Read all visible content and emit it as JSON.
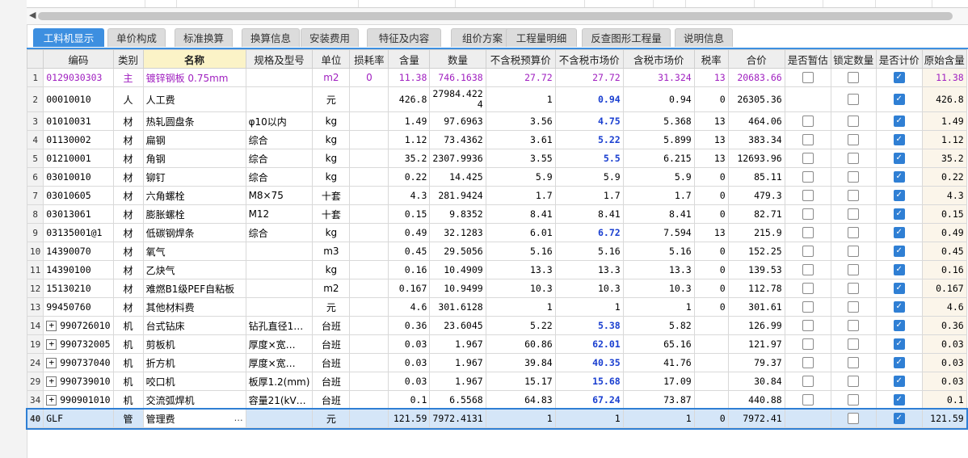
{
  "tabs": [
    {
      "label": "工料机显示",
      "active": true
    },
    {
      "label": "单价构成",
      "active": false
    },
    {
      "label": "标准换算",
      "active": false
    },
    {
      "label": "换算信息",
      "active": false
    },
    {
      "label": "安装费用",
      "active": false
    },
    {
      "label": "特征及内容",
      "active": false
    },
    {
      "label": "组价方案",
      "active": false
    },
    {
      "label": "工程量明细",
      "active": false
    },
    {
      "label": "反查图形工程量",
      "active": false
    },
    {
      "label": "说明信息",
      "active": false
    }
  ],
  "columns": [
    "编码",
    "类别",
    "名称",
    "规格及型号",
    "单位",
    "损耗率",
    "含量",
    "数量",
    "不含税预算价",
    "不含税市场价",
    "含税市场价",
    "税率",
    "合价",
    "是否暂估",
    "锁定数量",
    "是否计价",
    "原始含量"
  ],
  "rows": [
    {
      "idx": "1",
      "code": "0129030303",
      "cat": "主",
      "name": "镀锌钢板 0.75mm",
      "spec": "",
      "unit": "m2",
      "loss": "0",
      "content": "11.38",
      "qty": "746.1638",
      "pre": "27.72",
      "mkt": "27.72",
      "mkt_bold": false,
      "tax_mkt": "31.324",
      "rate": "13",
      "total": "20683.66",
      "est": false,
      "lock": false,
      "price": true,
      "orig": "11.38",
      "type": "main"
    },
    {
      "idx": "2",
      "code": "00010010",
      "cat": "人",
      "name": "人工费",
      "spec": "",
      "unit": "元",
      "loss": "",
      "content": "426.8",
      "qty": "27984.4224",
      "pre": "1",
      "mkt": "0.94",
      "mkt_bold": true,
      "tax_mkt": "0.94",
      "rate": "0",
      "total": "26305.36",
      "est": null,
      "lock": false,
      "price": true,
      "orig": "426.8",
      "type": "tall"
    },
    {
      "idx": "3",
      "code": "01010031",
      "cat": "材",
      "name": "热轧圆盘条",
      "spec": "φ10以内",
      "unit": "kg",
      "loss": "",
      "content": "1.49",
      "qty": "97.6963",
      "pre": "3.56",
      "mkt": "4.75",
      "mkt_bold": true,
      "tax_mkt": "5.368",
      "rate": "13",
      "total": "464.06",
      "est": false,
      "lock": false,
      "price": true,
      "orig": "1.49"
    },
    {
      "idx": "4",
      "code": "01130002",
      "cat": "材",
      "name": "扁钢",
      "spec": "综合",
      "unit": "kg",
      "loss": "",
      "content": "1.12",
      "qty": "73.4362",
      "pre": "3.61",
      "mkt": "5.22",
      "mkt_bold": true,
      "tax_mkt": "5.899",
      "rate": "13",
      "total": "383.34",
      "est": false,
      "lock": false,
      "price": true,
      "orig": "1.12"
    },
    {
      "idx": "5",
      "code": "01210001",
      "cat": "材",
      "name": "角钢",
      "spec": "综合",
      "unit": "kg",
      "loss": "",
      "content": "35.2",
      "qty": "2307.9936",
      "pre": "3.55",
      "mkt": "5.5",
      "mkt_bold": true,
      "tax_mkt": "6.215",
      "rate": "13",
      "total": "12693.96",
      "est": false,
      "lock": false,
      "price": true,
      "orig": "35.2"
    },
    {
      "idx": "6",
      "code": "03010010",
      "cat": "材",
      "name": "铆钉",
      "spec": "综合",
      "unit": "kg",
      "loss": "",
      "content": "0.22",
      "qty": "14.425",
      "pre": "5.9",
      "mkt": "5.9",
      "mkt_bold": false,
      "tax_mkt": "5.9",
      "rate": "0",
      "total": "85.11",
      "est": false,
      "lock": false,
      "price": true,
      "orig": "0.22"
    },
    {
      "idx": "7",
      "code": "03010605",
      "cat": "材",
      "name": "六角螺栓",
      "spec": "M8×75",
      "unit": "十套",
      "loss": "",
      "content": "4.3",
      "qty": "281.9424",
      "pre": "1.7",
      "mkt": "1.7",
      "mkt_bold": false,
      "tax_mkt": "1.7",
      "rate": "0",
      "total": "479.3",
      "est": false,
      "lock": false,
      "price": true,
      "orig": "4.3"
    },
    {
      "idx": "8",
      "code": "03013061",
      "cat": "材",
      "name": "膨胀螺栓",
      "spec": "M12",
      "unit": "十套",
      "loss": "",
      "content": "0.15",
      "qty": "9.8352",
      "pre": "8.41",
      "mkt": "8.41",
      "mkt_bold": false,
      "tax_mkt": "8.41",
      "rate": "0",
      "total": "82.71",
      "est": false,
      "lock": false,
      "price": true,
      "orig": "0.15"
    },
    {
      "idx": "9",
      "code": "03135001@1",
      "cat": "材",
      "name": "低碳钢焊条",
      "spec": "综合",
      "unit": "kg",
      "loss": "",
      "content": "0.49",
      "qty": "32.1283",
      "pre": "6.01",
      "mkt": "6.72",
      "mkt_bold": true,
      "tax_mkt": "7.594",
      "rate": "13",
      "total": "215.9",
      "est": false,
      "lock": false,
      "price": true,
      "orig": "0.49"
    },
    {
      "idx": "10",
      "code": "14390070",
      "cat": "材",
      "name": "氧气",
      "spec": "",
      "unit": "m3",
      "loss": "",
      "content": "0.45",
      "qty": "29.5056",
      "pre": "5.16",
      "mkt": "5.16",
      "mkt_bold": false,
      "tax_mkt": "5.16",
      "rate": "0",
      "total": "152.25",
      "est": false,
      "lock": false,
      "price": true,
      "orig": "0.45"
    },
    {
      "idx": "11",
      "code": "14390100",
      "cat": "材",
      "name": "乙炔气",
      "spec": "",
      "unit": "kg",
      "loss": "",
      "content": "0.16",
      "qty": "10.4909",
      "pre": "13.3",
      "mkt": "13.3",
      "mkt_bold": false,
      "tax_mkt": "13.3",
      "rate": "0",
      "total": "139.53",
      "est": false,
      "lock": false,
      "price": true,
      "orig": "0.16"
    },
    {
      "idx": "12",
      "code": "15130210",
      "cat": "材",
      "name": "难燃B1级PEF自粘板",
      "spec": "",
      "unit": "m2",
      "loss": "",
      "content": "0.167",
      "qty": "10.9499",
      "pre": "10.3",
      "mkt": "10.3",
      "mkt_bold": false,
      "tax_mkt": "10.3",
      "rate": "0",
      "total": "112.78",
      "est": false,
      "lock": false,
      "price": true,
      "orig": "0.167"
    },
    {
      "idx": "13",
      "code": "99450760",
      "cat": "材",
      "name": "其他材料费",
      "spec": "",
      "unit": "元",
      "loss": "",
      "content": "4.6",
      "qty": "301.6128",
      "pre": "1",
      "mkt": "1",
      "mkt_bold": false,
      "tax_mkt": "1",
      "rate": "0",
      "total": "301.61",
      "est": false,
      "lock": false,
      "price": true,
      "orig": "4.6"
    },
    {
      "idx": "14",
      "code": "990726010",
      "cat": "机",
      "name": "台式钻床",
      "spec": "钻孔直径1…",
      "unit": "台班",
      "loss": "",
      "content": "0.36",
      "qty": "23.6045",
      "pre": "5.22",
      "mkt": "5.38",
      "mkt_bold": true,
      "tax_mkt": "5.82",
      "rate": "",
      "total": "126.99",
      "est": false,
      "lock": false,
      "price": true,
      "orig": "0.36",
      "expand": true
    },
    {
      "idx": "19",
      "code": "990732005",
      "cat": "机",
      "name": "剪板机",
      "spec": "厚度×宽…",
      "unit": "台班",
      "loss": "",
      "content": "0.03",
      "qty": "1.967",
      "pre": "60.86",
      "mkt": "62.01",
      "mkt_bold": true,
      "tax_mkt": "65.16",
      "rate": "",
      "total": "121.97",
      "est": false,
      "lock": false,
      "price": true,
      "orig": "0.03",
      "expand": true
    },
    {
      "idx": "24",
      "code": "990737040",
      "cat": "机",
      "name": "折方机",
      "spec": "厚度×宽…",
      "unit": "台班",
      "loss": "",
      "content": "0.03",
      "qty": "1.967",
      "pre": "39.84",
      "mkt": "40.35",
      "mkt_bold": true,
      "tax_mkt": "41.76",
      "rate": "",
      "total": "79.37",
      "est": false,
      "lock": false,
      "price": true,
      "orig": "0.03",
      "expand": true
    },
    {
      "idx": "29",
      "code": "990739010",
      "cat": "机",
      "name": "咬口机",
      "spec": "板厚1.2(mm)",
      "unit": "台班",
      "loss": "",
      "content": "0.03",
      "qty": "1.967",
      "pre": "15.17",
      "mkt": "15.68",
      "mkt_bold": true,
      "tax_mkt": "17.09",
      "rate": "",
      "total": "30.84",
      "est": false,
      "lock": false,
      "price": true,
      "orig": "0.03",
      "expand": true
    },
    {
      "idx": "34",
      "code": "990901010",
      "cat": "机",
      "name": "交流弧焊机",
      "spec": "容量21(kV…",
      "unit": "台班",
      "loss": "",
      "content": "0.1",
      "qty": "6.5568",
      "pre": "64.83",
      "mkt": "67.24",
      "mkt_bold": true,
      "tax_mkt": "73.87",
      "rate": "",
      "total": "440.88",
      "est": false,
      "lock": false,
      "price": true,
      "orig": "0.1",
      "expand": true
    },
    {
      "idx": "40",
      "code": "GLF",
      "cat": "管",
      "name": "管理费",
      "spec": "",
      "unit": "元",
      "loss": "",
      "content": "121.59",
      "qty": "7972.4131",
      "pre": "1",
      "mkt": "1",
      "mkt_bold": false,
      "tax_mkt": "1",
      "rate": "0",
      "total": "7972.41",
      "est": null,
      "lock": false,
      "price": true,
      "orig": "121.59",
      "type": "selected"
    }
  ]
}
